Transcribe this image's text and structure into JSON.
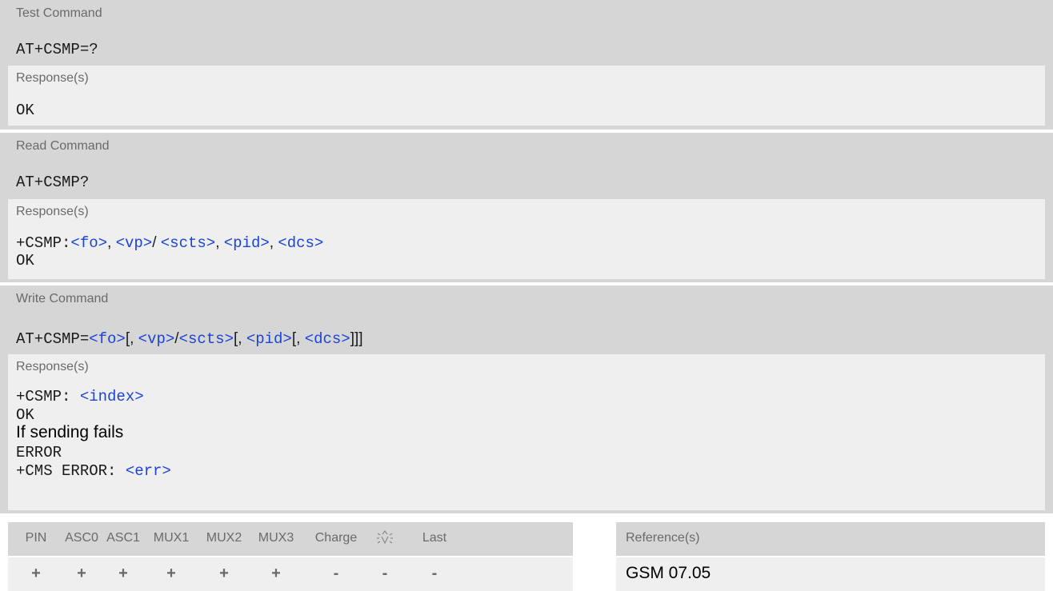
{
  "test": {
    "header": "Test Command",
    "command": "AT+CSMP=?",
    "response_label": "Response(s)",
    "response_lines": [
      "OK"
    ]
  },
  "read": {
    "header": "Read Command",
    "command": "AT+CSMP?",
    "response_label": "Response(s)",
    "response_prefix": "+CSMP:",
    "params": [
      "<fo>",
      "<vp>",
      "<scts>",
      "<pid>",
      "<dcs>"
    ],
    "sep_comma": ", ",
    "sep_slash": "/ ",
    "ok": "OK"
  },
  "write": {
    "header": "Write Command",
    "command_prefix": "AT+CSMP=",
    "params": [
      "<fo>",
      "<vp>",
      "<scts>",
      "<pid>",
      "<dcs>"
    ],
    "seps": [
      "[, ",
      "/",
      "[, ",
      "[, ",
      "]]]"
    ],
    "response_label": "Response(s)",
    "resp_prefix": "+CSMP: ",
    "resp_index": "<index>",
    "ok": "OK",
    "fail_text": "If sending fails",
    "error": "ERROR",
    "cms_prefix": "+CMS ERROR: ",
    "cms_err": "<err>"
  },
  "pin_table": {
    "headers": [
      "PIN",
      "ASC0",
      "ASC1",
      "MUX1",
      "MUX2",
      "MUX3",
      "Charge",
      "",
      "Last"
    ],
    "values": [
      "+",
      "+",
      "+",
      "+",
      "+",
      "+",
      "-",
      "-",
      "-"
    ],
    "icon": "power-off-icon"
  },
  "reference": {
    "label": "Reference(s)",
    "value": "GSM 07.05"
  },
  "colors": {
    "header_bg": "#d6d6d6",
    "body_bg": "#efefef",
    "link": "#1a44d6",
    "label": "#6a6a6a"
  }
}
